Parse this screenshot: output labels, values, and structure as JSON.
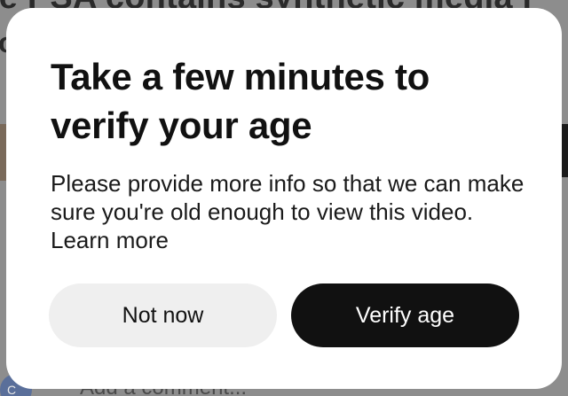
{
  "background": {
    "headline_fragment": "ie PSA contains synthetic media i",
    "left_letter": "o",
    "avatar_letter": "C",
    "comment_placeholder": "Add a comment..."
  },
  "modal": {
    "title": "Take a few minutes to verify your age",
    "body": "Please provide more info so that we can make sure you're old enough to view this video.",
    "learn_more": "Learn more",
    "secondary_button": "Not now",
    "primary_button": "Verify age"
  },
  "colors": {
    "primary_button_bg": "#111111",
    "secondary_button_bg": "#efefef",
    "overlay": "#8d8d8d"
  }
}
